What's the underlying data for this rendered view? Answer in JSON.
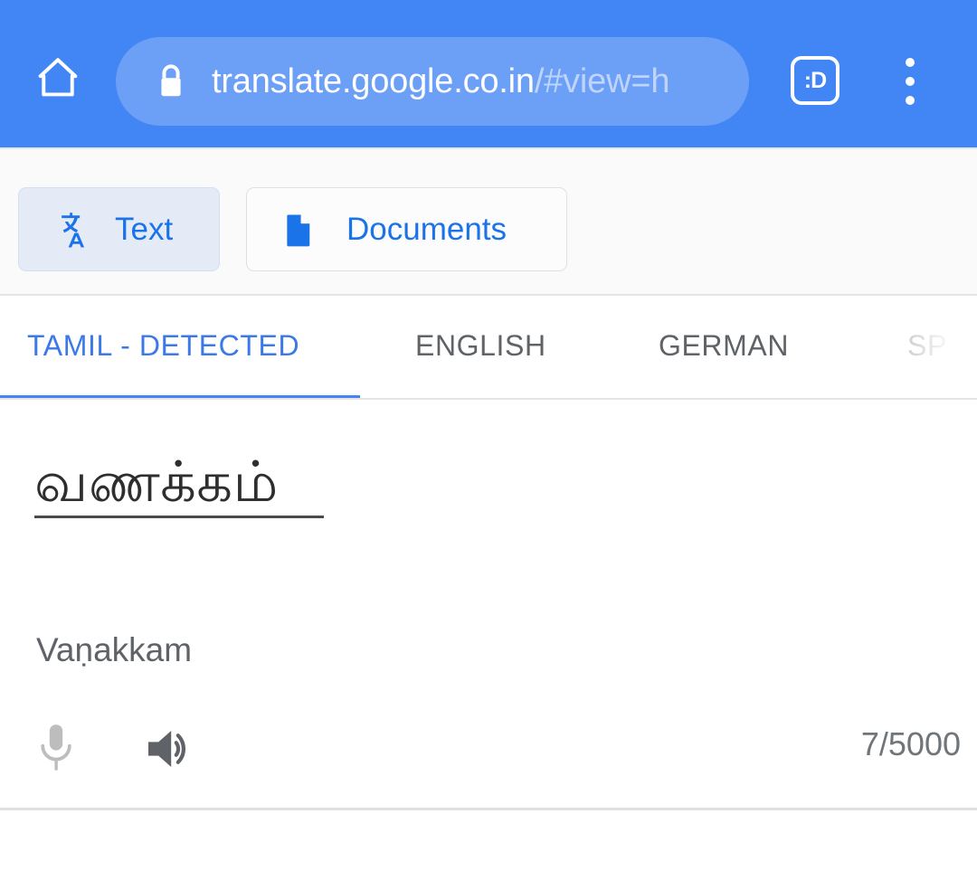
{
  "browser": {
    "home_icon": "home-icon",
    "lock_icon": "lock-icon",
    "url_host": "translate.google.co.in",
    "url_path": "/#view=h",
    "tab_count_label": ":D",
    "menu_icon": "overflow-menu-icon"
  },
  "mode_bar": {
    "buttons": [
      {
        "label": "Text",
        "icon": "translate-icon",
        "active": true
      },
      {
        "label": "Documents",
        "icon": "document-icon",
        "active": false
      }
    ]
  },
  "language_tabs": {
    "items": [
      {
        "label": "TAMIL - DETECTED",
        "active": true
      },
      {
        "label": "ENGLISH",
        "active": false
      },
      {
        "label": "GERMAN",
        "active": false
      },
      {
        "label": "SP",
        "active": false
      }
    ]
  },
  "source_panel": {
    "text": "வணக்கம்",
    "transliteration": "Vaṇakkam",
    "mic_icon": "microphone-icon",
    "speaker_icon": "speaker-icon",
    "char_counter": "7/5000"
  },
  "colors": {
    "brand_blue": "#4285F4",
    "url_pill": "#6C9FF6",
    "link_blue": "#1A73E8",
    "tab_active": "#3B79E8",
    "tab_inactive": "#5F6368",
    "toolbar_bg": "#FAFAFA",
    "active_chip_bg": "#E4EBF7",
    "mic_gray": "#BDBDBD",
    "speaker_gray": "#5F6368"
  }
}
